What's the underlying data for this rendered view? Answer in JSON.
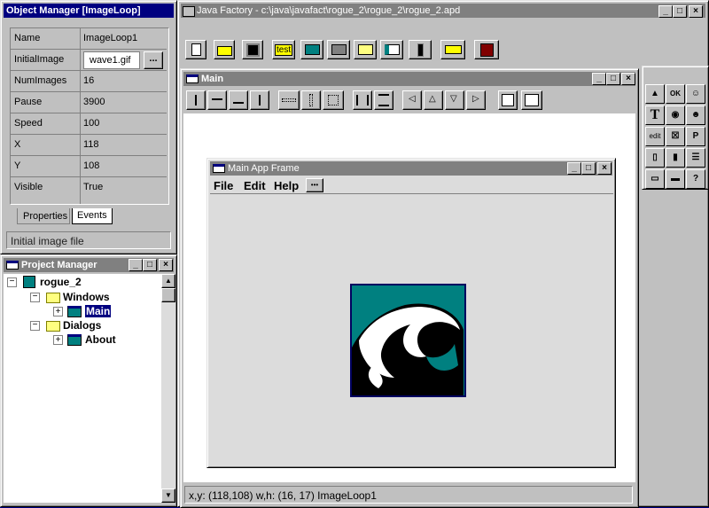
{
  "object_manager": {
    "title": "Object Manager [ImageLoop]",
    "properties": [
      {
        "name": "Name",
        "value": "ImageLoop1"
      },
      {
        "name": "InitialImage",
        "value": "wave1.gif"
      },
      {
        "name": "NumImages",
        "value": "16"
      },
      {
        "name": "Pause",
        "value": "3900"
      },
      {
        "name": "Speed",
        "value": "100"
      },
      {
        "name": "X",
        "value": "118"
      },
      {
        "name": "Y",
        "value": "108"
      },
      {
        "name": "Visible",
        "value": "True"
      }
    ],
    "browse_label": "...",
    "tabs": [
      "Properties",
      "Events"
    ],
    "description": "Initial image file"
  },
  "project_manager": {
    "title": "Project Manager",
    "root": "rogue_2",
    "windows_label": "Windows",
    "main_label": "Main",
    "dialogs_label": "Dialogs",
    "about_label": "About"
  },
  "java_factory": {
    "title": "Java Factory - c:\\java\\javafact\\rogue_2\\rogue_2\\rogue_2.apd",
    "test_label": "test"
  },
  "main_window": {
    "title": "Main",
    "status": "x,y: (118,108)  w,h: (16, 17)  ImageLoop1"
  },
  "app_frame": {
    "title": "Main App Frame",
    "menus": [
      "File",
      "Edit",
      "Help"
    ],
    "more_label": "•••"
  },
  "palette": {
    "ok_label": "OK",
    "edit_label": "edit",
    "p_label": "P",
    "t_label": "T",
    "q_label": "?"
  },
  "colors": {
    "title_active": "#000080",
    "desktop": "#000080",
    "wave_bg": "#008080"
  }
}
